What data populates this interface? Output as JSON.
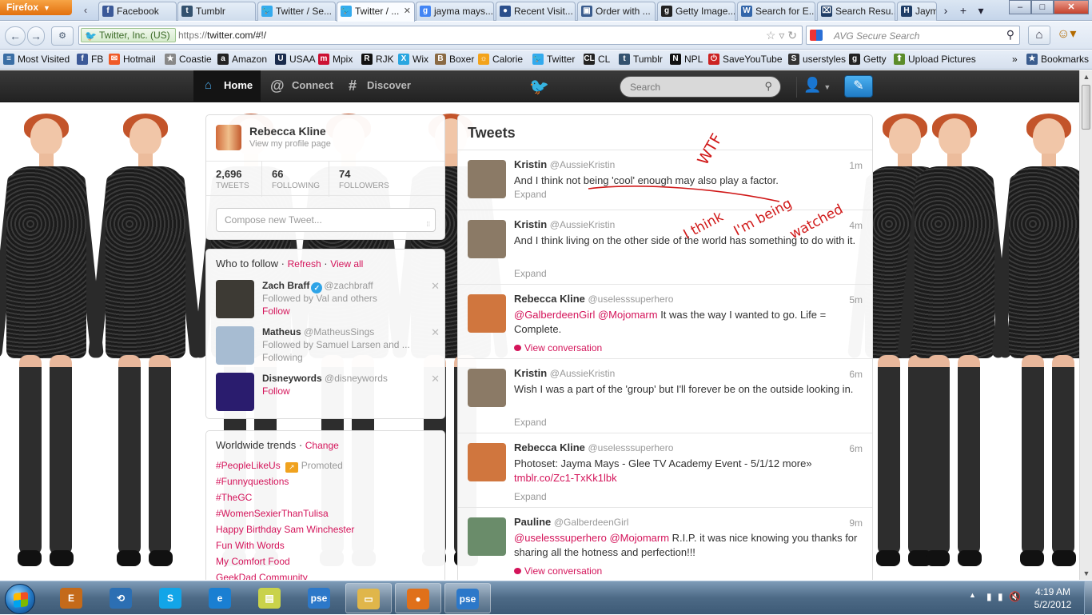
{
  "browser": {
    "app_button": "Firefox",
    "tabs": [
      {
        "label": "Facebook",
        "icon": "facebook-icon",
        "color": "#3b5998",
        "glyph": "f"
      },
      {
        "label": "Tumblr",
        "icon": "tumblr-icon",
        "color": "#34526f",
        "glyph": "t"
      },
      {
        "label": "Twitter / Se...",
        "icon": "twitter-bird-icon",
        "color": "#33aaee",
        "glyph": "🐦"
      },
      {
        "label": "Twitter / ...",
        "icon": "twitter-bird-icon",
        "color": "#33aaee",
        "glyph": "🐦",
        "active": true
      },
      {
        "label": "jayma mays...",
        "icon": "google-icon",
        "color": "#4285f4",
        "glyph": "g"
      },
      {
        "label": "Recent Visit...",
        "icon": "globe-icon",
        "color": "#2b4f8c",
        "glyph": "●"
      },
      {
        "label": "Order with ...",
        "icon": "page-icon",
        "color": "#3a5c8e",
        "glyph": "▣"
      },
      {
        "label": "Getty Image...",
        "icon": "getty-icon",
        "color": "#222222",
        "glyph": "g"
      },
      {
        "label": "Search for E...",
        "icon": "wikipedia-icon",
        "color": "#3366aa",
        "glyph": "W"
      },
      {
        "label": "Search Resu...",
        "icon": "imdb-icon",
        "color": "#1f3d66",
        "glyph": "⌧"
      },
      {
        "label": "Jayma",
        "icon": "page-icon",
        "color": "#1f3d66",
        "glyph": "H"
      }
    ],
    "site_identity": "Twitter, Inc. (US)",
    "url_scheme": "https://",
    "url_rest": "twitter.com/#!/",
    "search_placeholder": "AVG Secure Search",
    "bookmarks": [
      {
        "label": "Most Visited",
        "icon": "most-visited-icon",
        "color": "#3a6ea5",
        "glyph": "≡"
      },
      {
        "label": "FB",
        "icon": "facebook-icon",
        "color": "#3b5998",
        "glyph": "f"
      },
      {
        "label": "Hotmail",
        "icon": "hotmail-icon",
        "color": "#f05a28",
        "glyph": "✉"
      },
      {
        "label": "Coastie",
        "icon": "coastie-icon",
        "color": "#888888",
        "glyph": "★"
      },
      {
        "label": "Amazon",
        "icon": "amazon-icon",
        "color": "#222222",
        "glyph": "a"
      },
      {
        "label": "USAA",
        "icon": "usaa-icon",
        "color": "#1a2b4c",
        "glyph": "U"
      },
      {
        "label": "Mpix",
        "icon": "mpix-icon",
        "color": "#cc1133",
        "glyph": "m"
      },
      {
        "label": "RJK",
        "icon": "rjk-icon",
        "color": "#111111",
        "glyph": "R"
      },
      {
        "label": "Wix",
        "icon": "wix-icon",
        "color": "#29a6e0",
        "glyph": "X"
      },
      {
        "label": "Boxer",
        "icon": "boxer-icon",
        "color": "#8a6a44",
        "glyph": "B"
      },
      {
        "label": "Calorie",
        "icon": "calorie-icon",
        "color": "#f3a31b",
        "glyph": "☼"
      },
      {
        "label": "Twitter",
        "icon": "twitter-bird-icon",
        "color": "#33aaee",
        "glyph": "🐦"
      },
      {
        "label": "CL",
        "icon": "craigslist-icon",
        "color": "#222222",
        "glyph": "CL"
      },
      {
        "label": "Tumblr",
        "icon": "tumblr-icon",
        "color": "#34526f",
        "glyph": "t"
      },
      {
        "label": "NPL",
        "icon": "npl-icon",
        "color": "#111111",
        "glyph": "N"
      },
      {
        "label": "SaveYouTube",
        "icon": "saveyoutube-icon",
        "color": "#cc2222",
        "glyph": "⏻"
      },
      {
        "label": "userstyles",
        "icon": "userstyles-icon",
        "color": "#333333",
        "glyph": "S"
      },
      {
        "label": "Getty",
        "icon": "getty-icon",
        "color": "#222222",
        "glyph": "g"
      },
      {
        "label": "Upload Pictures",
        "icon": "upload-icon",
        "color": "#5b8c2a",
        "glyph": "⬆"
      }
    ],
    "bookmarks_overflow": "»",
    "bookmarks_menu": "Bookmarks"
  },
  "twitter": {
    "nav": {
      "home": "Home",
      "connect": "Connect",
      "discover": "Discover"
    },
    "search_placeholder": "Search",
    "profile": {
      "name": "Rebecca Kline",
      "sub": "View my profile page",
      "stats": [
        {
          "value": "2,696",
          "label": "TWEETS"
        },
        {
          "value": "66",
          "label": "FOLLOWING"
        },
        {
          "value": "74",
          "label": "FOLLOWERS"
        }
      ],
      "compose_placeholder": "Compose new Tweet..."
    },
    "who_to_follow": {
      "title": "Who to follow",
      "refresh": "Refresh",
      "view_all": "View all",
      "suggestions": [
        {
          "name": "Zach Braff",
          "handle": "@zachbraff",
          "meta": "Followed by Val and others",
          "action": "Follow",
          "verified": true,
          "color": "#3d3a34"
        },
        {
          "name": "Matheus",
          "handle": "@MatheusSings",
          "meta": "Followed by Samuel Larsen and ...",
          "action": "Following",
          "verified": false,
          "color": "#a7bcd2"
        },
        {
          "name": "Disneywords",
          "handle": "@disneywords",
          "meta": "",
          "action": "Follow",
          "verified": false,
          "color": "#2a1c6e"
        }
      ]
    },
    "trends": {
      "title": "Worldwide trends",
      "change": "Change",
      "promoted_label": "Promoted",
      "items": [
        "#PeopleLikeUs",
        "#Funnyquestions",
        "#TheGC",
        "#WomenSexierThanTulisa",
        "Happy Birthday Sam Winchester",
        "Fun With Words",
        "My Comfort Food",
        "GeekDad Community"
      ]
    },
    "timeline": {
      "title": "Tweets",
      "tweets": [
        {
          "name": "Kristin",
          "handle": "@AussieKristin",
          "time": "1m",
          "text": "And I think not being 'cool' enough may also play a factor.",
          "footer": "Expand",
          "color": "#8b7a66"
        },
        {
          "name": "Kristin",
          "handle": "@AussieKristin",
          "time": "4m",
          "text": "And I think living on the other side of the world has something to do with it.",
          "footer": "Expand",
          "color": "#8b7a66"
        },
        {
          "name": "Rebecca Kline",
          "handle": "@uselesssuperhero",
          "time": "5m",
          "mention1": "@GalberdeenGirl",
          "mention2": "@Mojomarm",
          "text": " It was the way I wanted to go. Life = Complete.",
          "footer": "View conversation",
          "color": "#d0763e"
        },
        {
          "name": "Kristin",
          "handle": "@AussieKristin",
          "time": "6m",
          "text": "Wish I was a part of the 'group' but I'll forever be on the outside looking in.",
          "footer": "Expand",
          "color": "#8b7a66"
        },
        {
          "name": "Rebecca Kline",
          "handle": "@uselesssuperhero",
          "time": "6m",
          "text": "Photoset: Jayma Mays - Glee TV Academy Event - 5/1/12 more»",
          "link": "tmblr.co/Zc1-TxKk1lbk",
          "footer": "Expand",
          "color": "#d0763e"
        },
        {
          "name": "Pauline",
          "handle": "@GalberdeenGirl",
          "time": "9m",
          "mention1": "@uselesssuperhero",
          "mention2": "@Mojomarm",
          "text": " R.I.P. it was nice knowing you thanks for sharing all the hotness and perfection!!!",
          "footer": "View conversation",
          "color": "#6a8c6a"
        }
      ]
    },
    "annotations": {
      "top": "WTF",
      "bottom_line1": "I think",
      "bottom_line2": "I'm being",
      "bottom_line3": "watched"
    }
  },
  "taskbar": {
    "apps": [
      {
        "name": "taskbar-eudora-button",
        "icon": "eudora-icon",
        "glyph": "E",
        "color": "#c46a1a",
        "open": false
      },
      {
        "name": "taskbar-sync-button",
        "icon": "sync-icon",
        "glyph": "⟲",
        "color": "#2c6fb3",
        "open": false
      },
      {
        "name": "taskbar-skype-button",
        "icon": "skype-icon",
        "glyph": "S",
        "color": "#12a5e8",
        "open": false
      },
      {
        "name": "taskbar-ie-button",
        "icon": "internet-explorer-icon",
        "glyph": "e",
        "color": "#1a7fd2",
        "open": false
      },
      {
        "name": "taskbar-notes-button",
        "icon": "notes-icon",
        "glyph": "▤",
        "color": "#c9d24a",
        "open": false
      },
      {
        "name": "taskbar-pse-button",
        "icon": "photoshop-elements-icon",
        "glyph": "pse",
        "color": "#2c78c9",
        "open": false
      },
      {
        "name": "taskbar-explorer-button",
        "icon": "folder-icon",
        "glyph": "▭",
        "color": "#e0b64a",
        "open": true
      },
      {
        "name": "taskbar-firefox-button",
        "icon": "firefox-icon",
        "glyph": "●",
        "color": "#e0701a",
        "open": true
      },
      {
        "name": "taskbar-pse2-button",
        "icon": "photoshop-elements-icon",
        "glyph": "pse",
        "color": "#2c78c9",
        "open": true
      }
    ],
    "time": "4:19 AM",
    "date": "5/2/2012"
  }
}
